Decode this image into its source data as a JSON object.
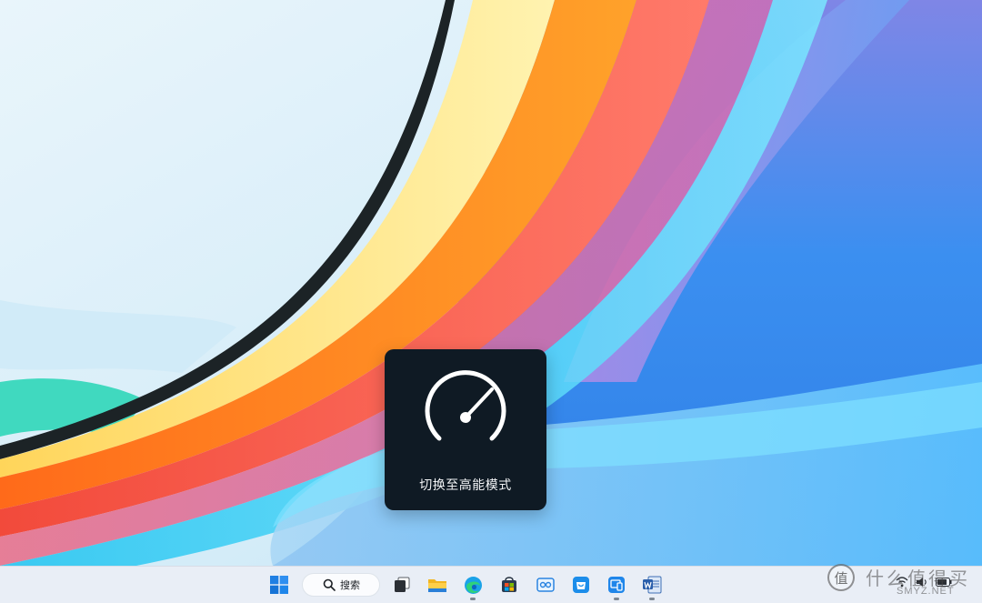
{
  "osd": {
    "label": "切换至高能模式",
    "icon": "speedometer-icon"
  },
  "taskbar": {
    "search_label": "搜索",
    "items": [
      {
        "name": "start-button",
        "icon": "windows-logo-icon"
      },
      {
        "name": "search-box",
        "icon": "search-icon"
      },
      {
        "name": "task-view",
        "icon": "task-view-icon"
      },
      {
        "name": "file-explorer",
        "icon": "folder-icon"
      },
      {
        "name": "edge",
        "icon": "edge-browser-icon"
      },
      {
        "name": "microsoft-store",
        "icon": "store-icon"
      },
      {
        "name": "app-photos",
        "icon": "photos-app-icon"
      },
      {
        "name": "app-shopping",
        "icon": "shopping-bag-icon"
      },
      {
        "name": "app-devices",
        "icon": "device-connect-icon"
      },
      {
        "name": "word",
        "icon": "word-icon"
      }
    ],
    "tray_icons": [
      "wifi-icon",
      "speaker-icon",
      "battery-icon"
    ]
  },
  "watermark": {
    "text": "什么值得买",
    "sub": "SMYZ.NET",
    "logo_glyph": "值"
  },
  "colors": {
    "osd_bg": "#0f1a24",
    "taskbar_bg": "#e9eef6",
    "accent_blue": "#1e7fe0"
  }
}
